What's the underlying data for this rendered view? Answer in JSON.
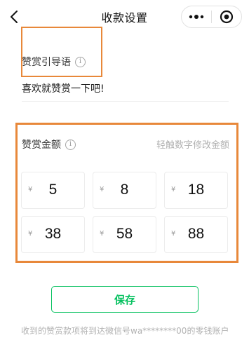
{
  "nav": {
    "title": "收款设置",
    "back_icon": "chevron-left-icon",
    "more_icon": "more-dots-icon",
    "close_icon": "circle-target-icon"
  },
  "guide": {
    "label": "赞赏引导语",
    "info_glyph": "i",
    "text": "喜欢就赞赏一下吧!"
  },
  "amount": {
    "label": "赞赏金额",
    "info_glyph": "i",
    "hint": "轻触数字修改金额",
    "currency": "¥",
    "items": [
      {
        "value": "5"
      },
      {
        "value": "8"
      },
      {
        "value": "18"
      },
      {
        "value": "38"
      },
      {
        "value": "58"
      },
      {
        "value": "88"
      }
    ]
  },
  "actions": {
    "save_label": "保存"
  },
  "footer": {
    "note": "收到的赞赏款项将到达微信号wa********00的零钱账户"
  },
  "colors": {
    "accent": "#07c160",
    "highlight": "#e8883a"
  }
}
